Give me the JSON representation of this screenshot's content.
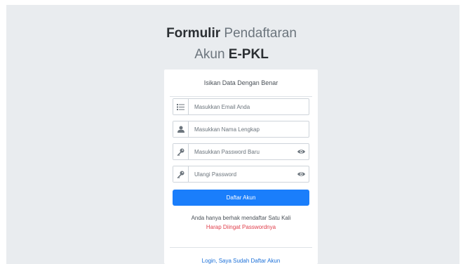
{
  "header": {
    "title_bold_1": "Formulir",
    "title_light_1": "Pendaftaran",
    "title_light_2": "Akun",
    "title_bold_2": "E-PKL"
  },
  "form": {
    "heading": "Isikan Data Dengan Benar",
    "fields": [
      {
        "placeholder": "Masukkan Email Anda",
        "icon": "list-icon"
      },
      {
        "placeholder": "Masukkan Nama Lengkap",
        "icon": "user-icon"
      },
      {
        "placeholder": "Masukkan Password Baru",
        "icon": "key-icon"
      },
      {
        "placeholder": "Ulangi Password",
        "icon": "key-icon"
      }
    ],
    "submit_label": "Daftar Akun",
    "note": "Anda hanya berhak mendaftar Satu Kali",
    "warning": "Harap Diingat Passwordnya",
    "login_link": "Login, Saya Sudah Daftar Akun"
  },
  "colors": {
    "background": "#e9ecef",
    "primary": "#1a7efb",
    "warning": "#e03e4b",
    "link": "#1a6fd8"
  }
}
